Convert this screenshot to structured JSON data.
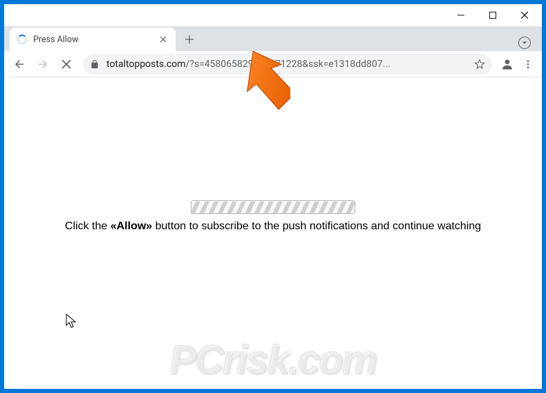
{
  "window": {
    "controls": {
      "minimize": "–",
      "maximize": "▢",
      "close": "✕"
    }
  },
  "tab": {
    "title": "Press Allow",
    "loading": true
  },
  "toolbar": {
    "url_host": "totaltopposts.com",
    "url_path": "/?s=458065829783671228&ssk=e1318dd807..."
  },
  "page": {
    "message_prefix": "Click the ",
    "message_allow": "«Allow»",
    "message_suffix": " button to subscribe to the push notifications and continue watching"
  },
  "watermark": {
    "text": "PCrisk.com"
  },
  "icons": {
    "back": "back-icon",
    "forward": "forward-icon",
    "stop": "stop-icon",
    "lock": "lock-icon",
    "star": "star-icon",
    "profile": "profile-icon",
    "menu": "menu-icon",
    "newtab": "plus-icon",
    "close_tab": "close-icon",
    "media": "media-badge-icon"
  }
}
